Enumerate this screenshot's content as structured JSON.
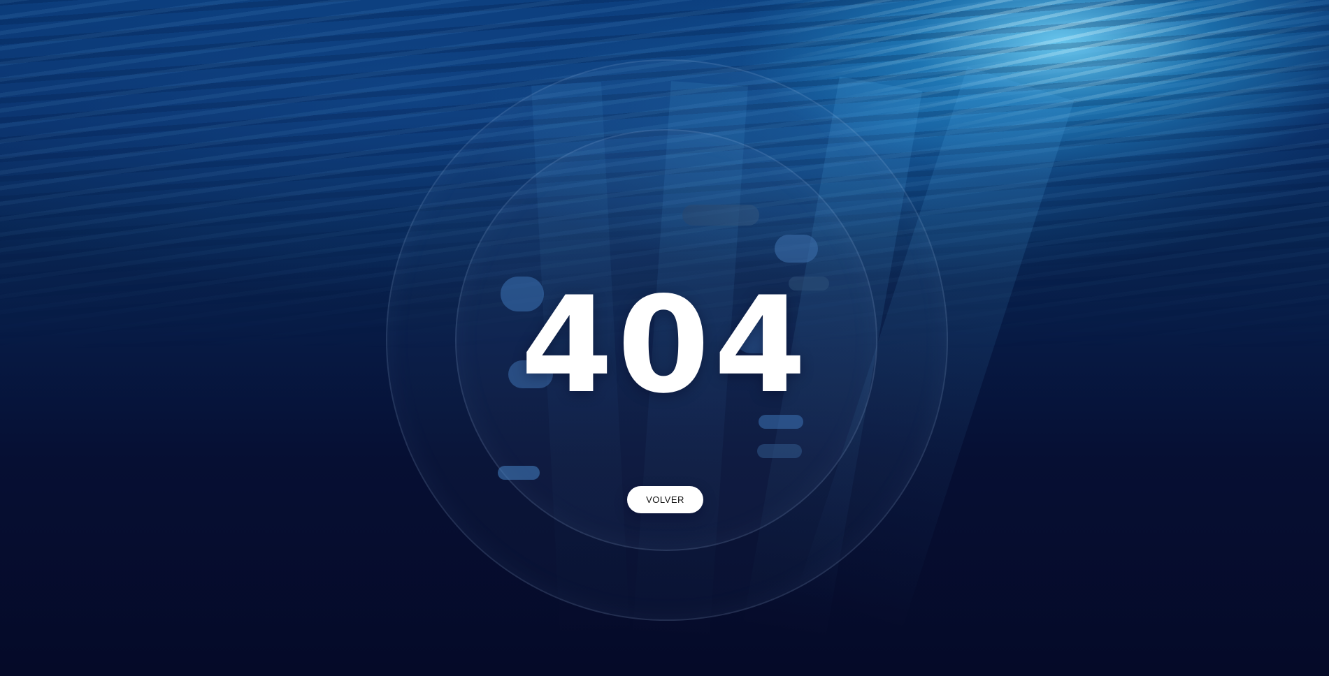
{
  "error": {
    "code": "404"
  },
  "actions": {
    "back_label": "VOLVER"
  },
  "colors": {
    "deep_water": "#050a26",
    "mid_water": "#0a2f68",
    "light_rays": "#78dcff",
    "button_bg": "#ffffff",
    "button_text": "#111111"
  }
}
